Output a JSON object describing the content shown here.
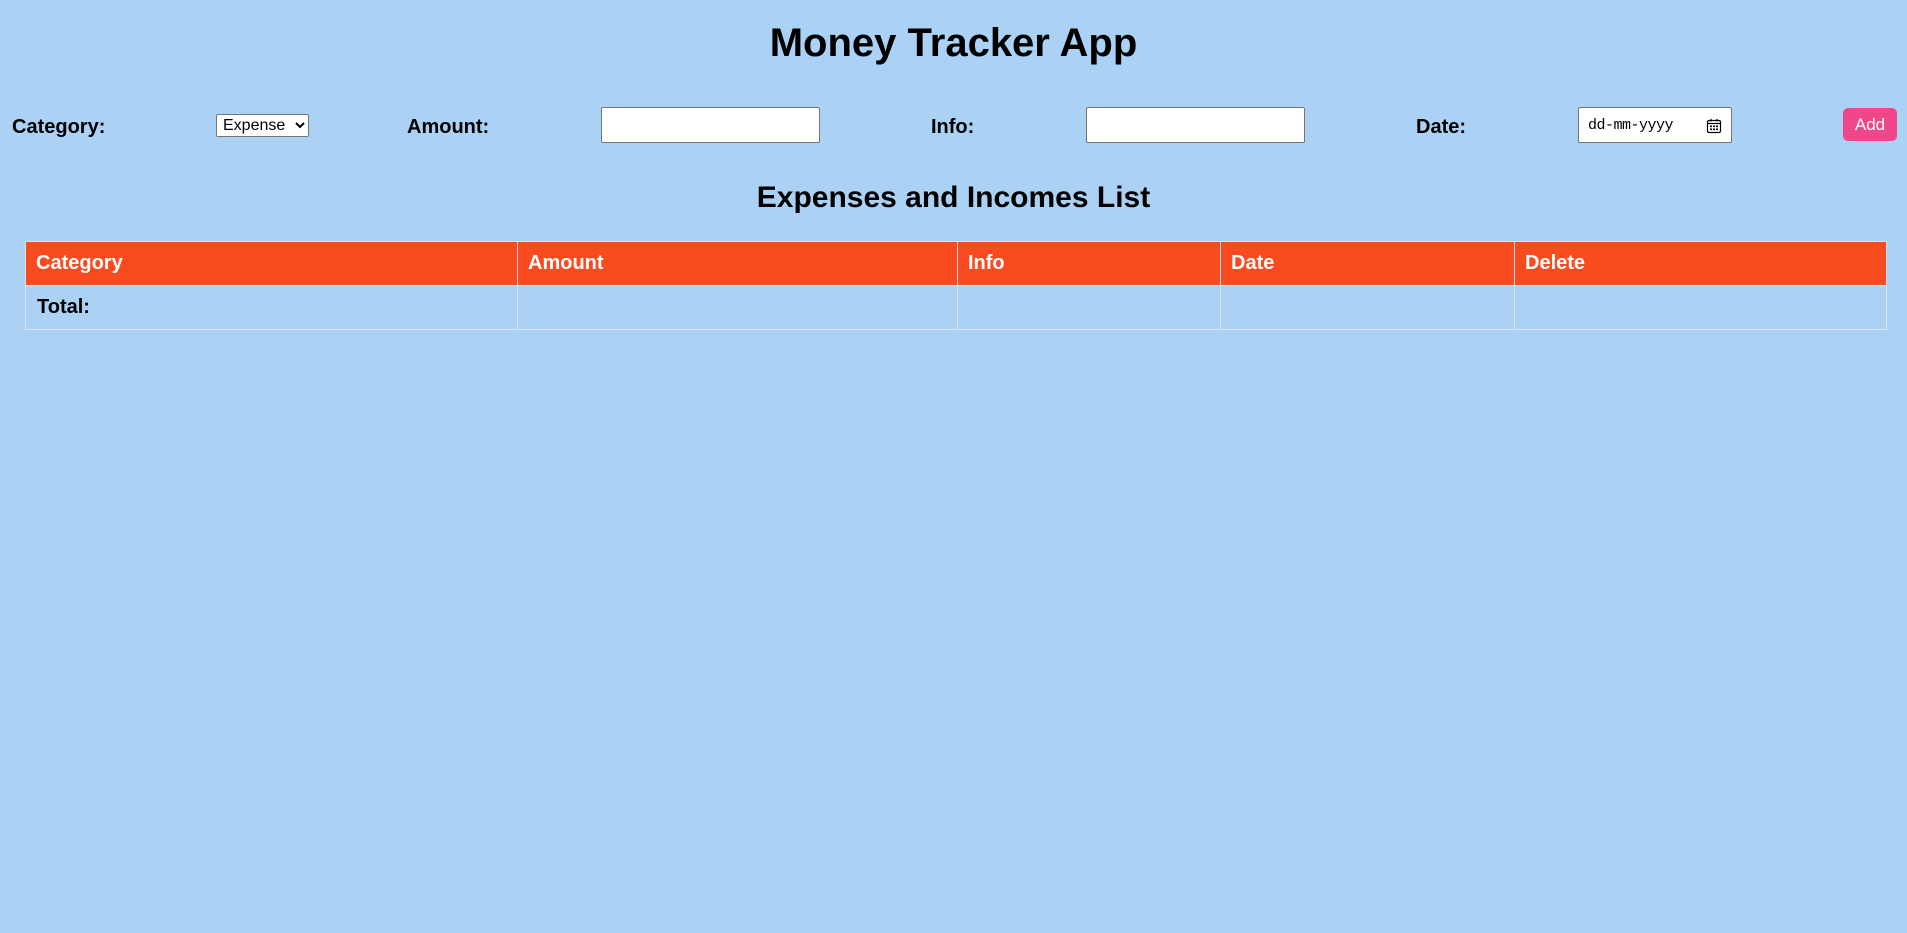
{
  "app": {
    "title": "Money Tracker App"
  },
  "form": {
    "category_label": "Category:",
    "category_options": [
      "Expense"
    ],
    "category_selected": "Expense",
    "amount_label": "Amount:",
    "amount_value": "",
    "info_label": "Info:",
    "info_value": "",
    "date_label": "Date:",
    "date_placeholder": "dd-mm-yyyy",
    "add_label": "Add"
  },
  "list": {
    "title": "Expenses and Incomes List",
    "columns": [
      "Category",
      "Amount",
      "Info",
      "Date",
      "Delete"
    ],
    "rows": [],
    "total_label": "Total:"
  },
  "colors": {
    "background": "#abd1f5",
    "table_header": "#f84b20",
    "add_button": "#f0478a"
  },
  "icons": {
    "date_picker": "calendar-icon",
    "select_arrow": "chevron-down-icon"
  }
}
